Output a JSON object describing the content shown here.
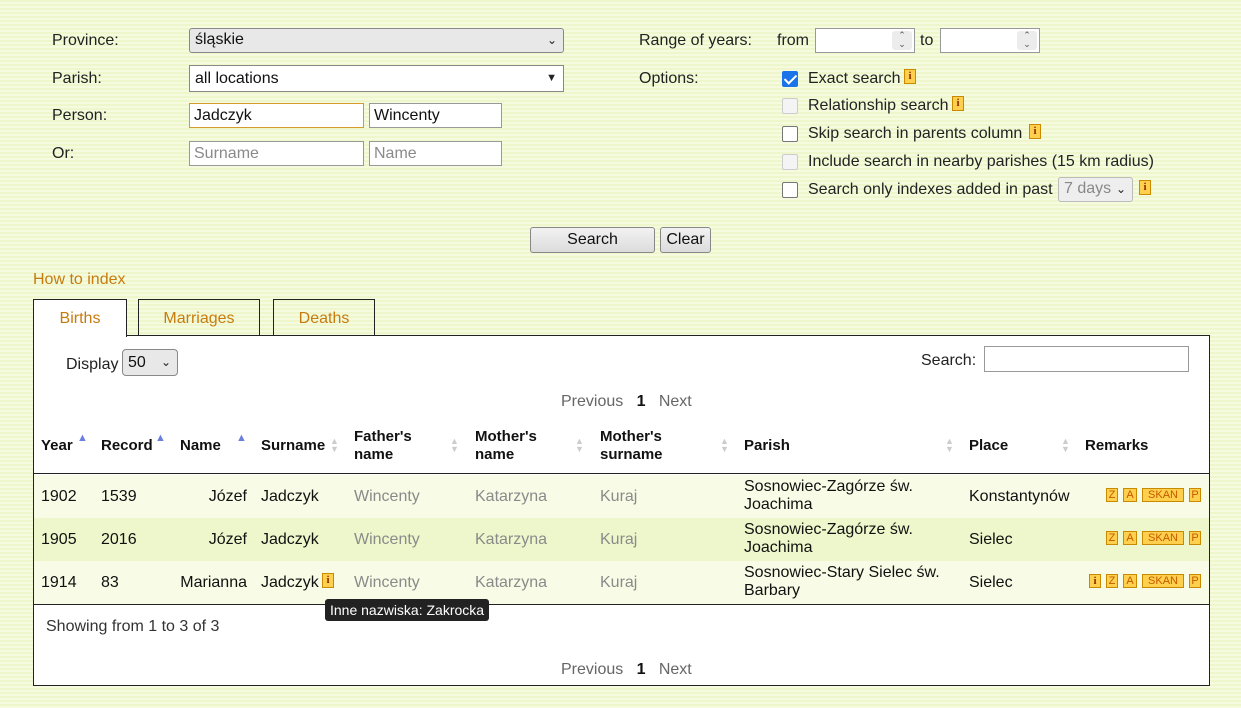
{
  "form": {
    "province_label": "Province:",
    "province_value": "śląskie",
    "parish_label": "Parish:",
    "parish_value": "all locations",
    "person_label": "Person:",
    "person_surname": "Jadczyk",
    "person_name": "Wincenty",
    "or_label": "Or:",
    "or_surname_placeholder": "Surname",
    "or_name_placeholder": "Name",
    "range_label": "Range of years:",
    "from_label": "from",
    "to_label": "to",
    "options_label": "Options:",
    "options": [
      {
        "label": "Exact search",
        "checked": true,
        "info": true
      },
      {
        "label": "Relationship search",
        "checked": false,
        "disabled": true,
        "info": true
      },
      {
        "label": "Skip search in parents column",
        "checked": false,
        "info": true
      },
      {
        "label": "Include search in nearby parishes (15 km radius)",
        "checked": false,
        "disabled": true
      },
      {
        "label": "Search only indexes added in past",
        "checked": false,
        "info": true
      }
    ],
    "past_days_value": "7 days",
    "search_button": "Search",
    "clear_button": "Clear"
  },
  "how_to_index": "How to index",
  "tabs": [
    {
      "label": "Births",
      "active": true
    },
    {
      "label": "Marriages",
      "active": false
    },
    {
      "label": "Deaths",
      "active": false
    }
  ],
  "table_controls": {
    "display_label": "Display",
    "display_value": "50",
    "search_label": "Search:",
    "search_value": "",
    "prev": "Previous",
    "page": "1",
    "next": "Next"
  },
  "columns": {
    "year": "Year",
    "record": "Record",
    "name": "Name",
    "surname": "Surname",
    "father_line1": "Father's",
    "father_line2": "name",
    "mother_line1": "Mother's",
    "mother_line2": "name",
    "msurname_line1": "Mother's",
    "msurname_line2": "surname",
    "parish": "Parish",
    "place": "Place",
    "remarks": "Remarks"
  },
  "rows": [
    {
      "year": "1902",
      "record": "1539",
      "name": "Józef",
      "surname": "Jadczyk",
      "father": "Wincenty",
      "mother": "Katarzyna",
      "mother_surname": "Kuraj",
      "parish_line1": "Sosnowiec-Zagórze św.",
      "parish_line2": "Joachima",
      "place": "Konstantynów",
      "badges": [
        "Z",
        "A",
        "SKAN",
        "P"
      ]
    },
    {
      "year": "1905",
      "record": "2016",
      "name": "Józef",
      "surname": "Jadczyk",
      "father": "Wincenty",
      "mother": "Katarzyna",
      "mother_surname": "Kuraj",
      "parish_line1": "Sosnowiec-Zagórze św.",
      "parish_line2": "Joachima",
      "place": "Sielec",
      "badges": [
        "Z",
        "A",
        "SKAN",
        "P"
      ]
    },
    {
      "year": "1914",
      "record": "83",
      "name": "Marianna",
      "surname": "Jadczyk",
      "father": "Wincenty",
      "mother": "Katarzyna",
      "mother_surname": "Kuraj",
      "parish_line1": "Sosnowiec-Stary Sielec św.",
      "parish_line2": "Barbary",
      "place": "Sielec",
      "badges": [
        "i",
        "Z",
        "A",
        "SKAN",
        "P"
      ]
    }
  ],
  "tooltip": "Inne nazwiska: Zakrocka",
  "showing": "Showing from 1 to 3 of 3",
  "colors": {
    "link": "#c77b0e",
    "badge": "#ffd04d",
    "sort_active": "#6a7fe0"
  }
}
